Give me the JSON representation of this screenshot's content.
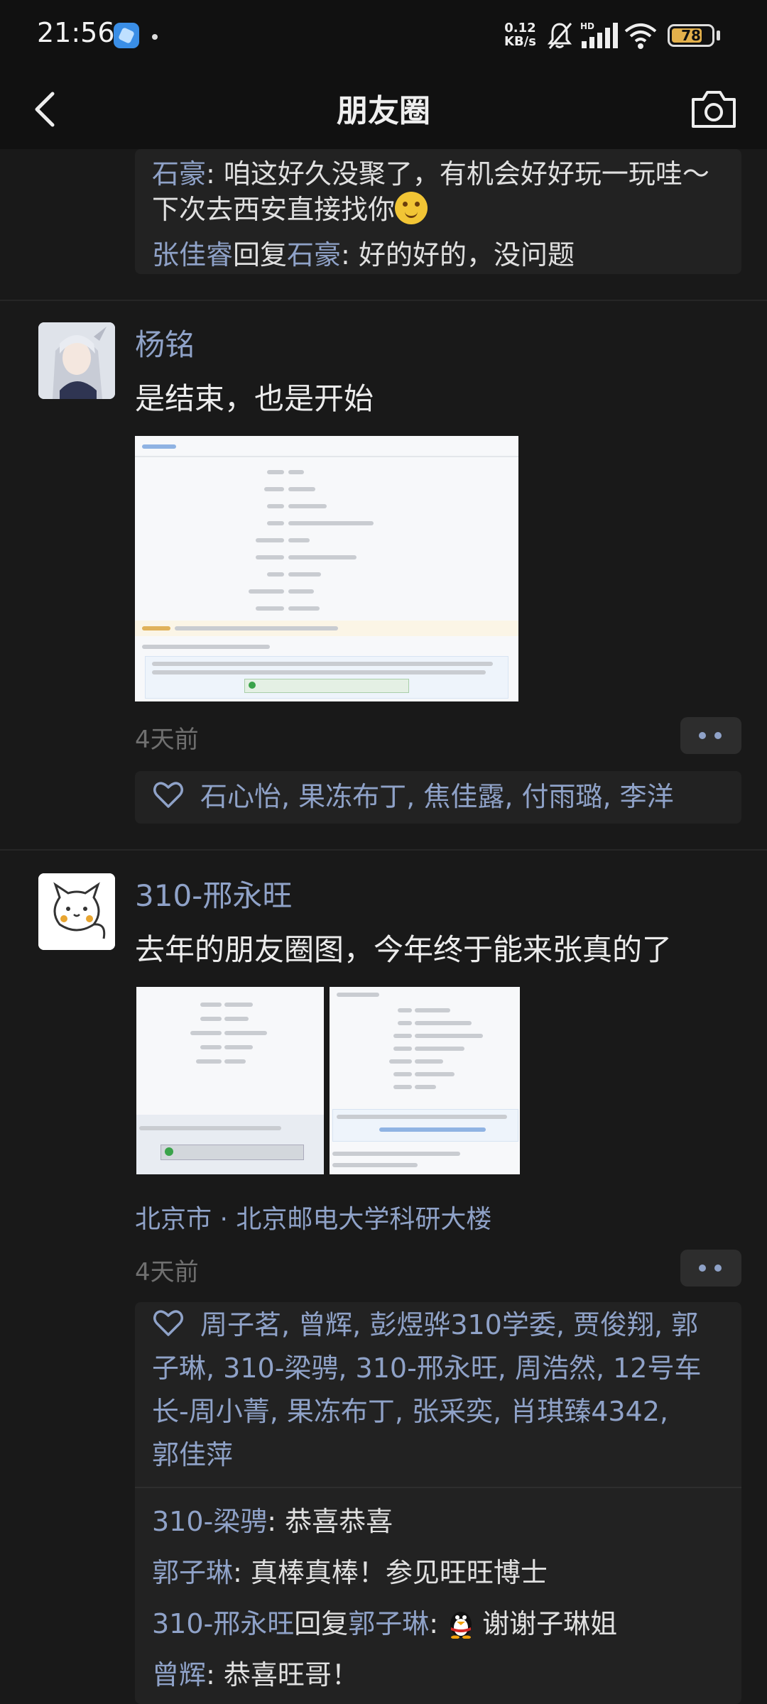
{
  "status": {
    "time": "21:56",
    "net_speed_value": "0.12",
    "net_speed_unit": "KB/s",
    "network_label": "HD",
    "battery": "78",
    "battery_fraction": 0.78
  },
  "header": {
    "title": "朋友圈"
  },
  "top_comments": [
    {
      "name": "石豪",
      "sep": ": ",
      "text": "咱这好久没聚了，有机会好好玩一玩哇～",
      "text2": "下次去西安直接找你"
    },
    {
      "name": "张佳睿",
      "reply_word": "回复",
      "to": "石豪",
      "sep": ": ",
      "text": "好的好的，没问题"
    }
  ],
  "posts": [
    {
      "name": "杨铭",
      "text": "是结束，也是开始",
      "time": "4天前",
      "likes": "石心怡, 果冻布丁, 焦佳露, 付雨璐, 李洋"
    },
    {
      "name": "310-邢永旺",
      "text": "去年的朋友圈图，今年终于能来张真的了",
      "location": "北京市 · 北京邮电大学科研大楼",
      "time": "4天前",
      "likes_line1": "周子茗, 曾辉, 彭煜骅310学委, 贾俊翔, 郭",
      "likes_line2": "子琳, 310-梁骋, 310-邢永旺, 周浩然, 12号车",
      "likes_line3": "长-周小菁, 果冻布丁, 张采奕, 肖琪臻4342,",
      "likes_line4": "郭佳萍",
      "comments": [
        {
          "name": "310-梁骋",
          "sep": ": ",
          "text": "恭喜恭喜"
        },
        {
          "name": "郭子琳",
          "sep": ": ",
          "text": "真棒真棒！参见旺旺博士"
        },
        {
          "name": "310-邢永旺",
          "reply_word": "回复",
          "to": "郭子琳",
          "sep": ": ",
          "text": "谢谢子琳姐"
        },
        {
          "name": "曾辉",
          "sep": ": ",
          "text": "恭喜旺哥！"
        }
      ]
    }
  ]
}
